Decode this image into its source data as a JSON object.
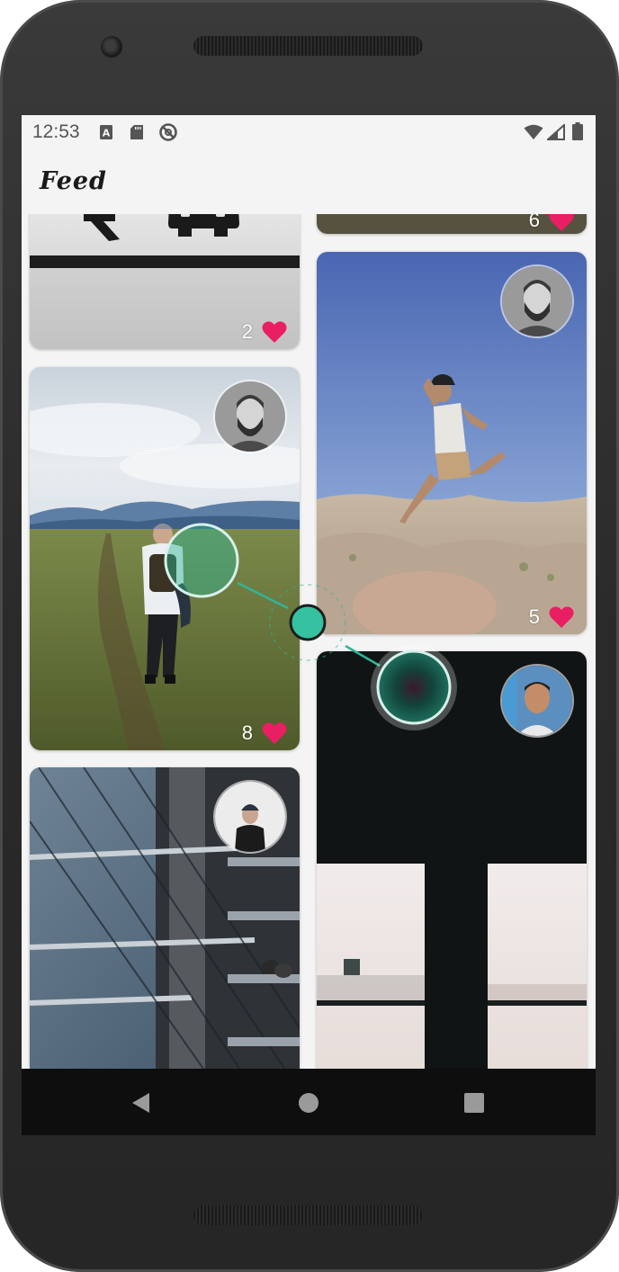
{
  "status_bar": {
    "time": "12:53",
    "left_icons": [
      "a-box-icon",
      "sd-card-icon",
      "do-not-disturb-icon"
    ],
    "right_icons": [
      "wifi-icon",
      "cell-signal-icon",
      "battery-icon"
    ]
  },
  "app_bar": {
    "title": "Feed"
  },
  "colors": {
    "accent_heart": "#e91e63",
    "touch_teal": "#2fb596",
    "screen_bg": "#f4f4f4",
    "nav_bg": "#0e0e0e"
  },
  "feed": {
    "cards": [
      {
        "id": "car-sign",
        "likes": "2",
        "avatar": null
      },
      {
        "id": "hiker-field",
        "likes": "8",
        "avatar": "bearded-man-avatar"
      },
      {
        "id": "glass-building",
        "likes": null,
        "avatar": "man-beanie-avatar"
      },
      {
        "id": "desert-top",
        "likes": "6",
        "avatar": null
      },
      {
        "id": "jumping-man",
        "likes": "5",
        "avatar": "bearded-man-avatar"
      },
      {
        "id": "dark-window",
        "likes": null,
        "avatar": "smiling-boy-avatar"
      }
    ]
  },
  "nav_bar": {
    "buttons": [
      "back-icon",
      "home-icon",
      "recents-icon"
    ]
  }
}
